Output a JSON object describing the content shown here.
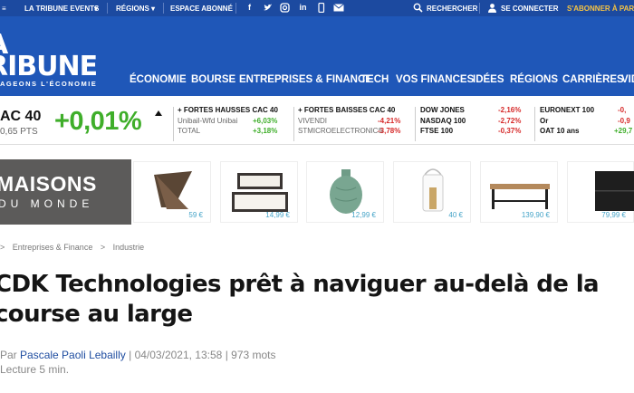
{
  "topbar": {
    "events": "LA TRIBUNE EVENTS",
    "regions": "RÉGIONS",
    "subscriber": "ESPACE ABONNÉ",
    "search": "RECHERCHER",
    "login": "SE CONNECTER",
    "subscribe": "S'ABONNER À PART"
  },
  "header": {
    "logo_line1": "A",
    "logo_line2": "RIBUNE",
    "logo_tagline": "AGEONS L'ÉCONOMIE",
    "nav": [
      "ÉCONOMIE",
      "BOURSE",
      "ENTREPRISES & FINANCE",
      "TECH",
      "VOS FINANCES",
      "IDÉES",
      "RÉGIONS",
      "CARRIÈRES",
      "VID"
    ]
  },
  "market": {
    "index_name": "AC 40",
    "index_points": "0,65 PTS",
    "index_change": "+0,01%",
    "hausses": {
      "title": "+ FORTES HAUSSES CAC 40",
      "rows": [
        {
          "name": "Unibail-Wfd Unibai",
          "value": "+6,03%"
        },
        {
          "name": "TOTAL",
          "value": "+3,18%"
        }
      ]
    },
    "baisses": {
      "title": "+ FORTES BAISSES CAC 40",
      "rows": [
        {
          "name": "VIVENDI",
          "value": "-4,21%"
        },
        {
          "name": "STMICROELECTRONICS",
          "value": "-3,78%"
        }
      ]
    },
    "indices": [
      {
        "name": "DOW JONES",
        "value": "-2,16%"
      },
      {
        "name": "NASDAQ 100",
        "value": "-2,72%"
      },
      {
        "name": "FTSE 100",
        "value": "-0,37%"
      }
    ],
    "others": [
      {
        "name": "EURONEXT 100",
        "value": "-0,"
      },
      {
        "name": "Or",
        "value": "-0,9"
      },
      {
        "name": "OAT 10 ans",
        "value": "+29,7"
      }
    ]
  },
  "ad": {
    "brand_line1": "MAISONS",
    "brand_line2": "DU MONDE",
    "products": [
      {
        "icon": "magazine-rack-icon",
        "price": "59 €"
      },
      {
        "icon": "storage-boxes-icon",
        "price": "14,99 €"
      },
      {
        "icon": "green-vase-icon",
        "price": "12,99 €"
      },
      {
        "icon": "lantern-icon",
        "price": "40 €"
      },
      {
        "icon": "bench-icon",
        "price": "139,90 €"
      },
      {
        "icon": "black-cabinet-icon",
        "price": "79,99 €"
      }
    ]
  },
  "breadcrumb": {
    "sep": ">",
    "items": [
      "Entreprises & Finance",
      "Industrie"
    ]
  },
  "article": {
    "title": "CDK Technologies prêt à naviguer au-delà de la course au large",
    "by": "Par",
    "author": "Pascale Paoli Lebailly",
    "date": "04/03/2021, 13:58",
    "words": "973 mots",
    "read_time": "Lecture 5 min."
  },
  "colors": {
    "topbar": "#1c4aa0",
    "header": "#1f57b8",
    "up": "#3fae2a",
    "down": "#d62a2a"
  }
}
